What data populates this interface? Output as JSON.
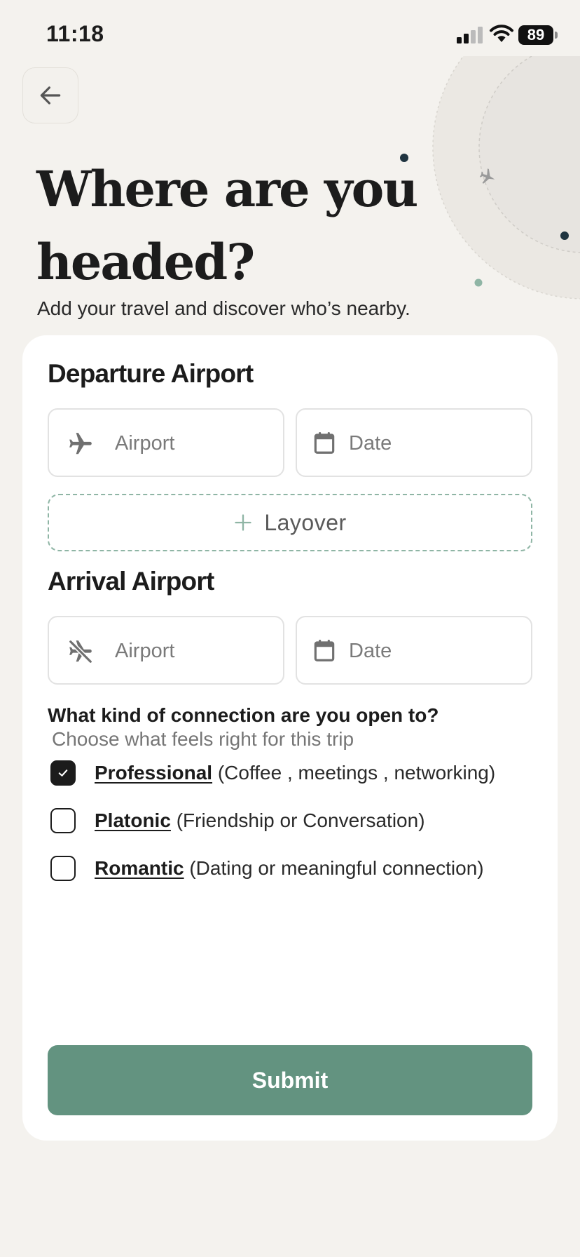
{
  "status_bar": {
    "time": "11:18",
    "battery_level": "89",
    "signal_bars_active": 2,
    "signal_bars_total": 4
  },
  "header": {
    "title": "Where are you headed?",
    "subtitle": "Add your travel and discover who’s nearby."
  },
  "departure": {
    "section_title": "Departure Airport",
    "airport_placeholder": "Airport",
    "date_placeholder": "Date",
    "airport_icon": "airplane-icon",
    "date_icon": "calendar-icon"
  },
  "layover": {
    "label": "Layover",
    "icon": "plus-icon"
  },
  "arrival": {
    "section_title": "Arrival Airport",
    "airport_placeholder": "Airport",
    "date_placeholder": "Date",
    "airport_icon": "airplane-off-icon",
    "date_icon": "calendar-icon"
  },
  "connection": {
    "question": "What kind of connection are you open to?",
    "hint": "Choose what feels right for this trip",
    "options": [
      {
        "name": "Professional",
        "description": "(Coffee , meetings , networking)",
        "checked": true
      },
      {
        "name": "Platonic",
        "description": "(Friendship or Conversation)",
        "checked": false
      },
      {
        "name": "Romantic",
        "description": "(Dating or meaningful connection)",
        "checked": false
      }
    ]
  },
  "submit": {
    "label": "Submit"
  },
  "colors": {
    "background": "#f4f2ee",
    "card": "#ffffff",
    "accent": "#639380",
    "dashed_border": "#8fb5a5",
    "text_primary": "#1c1c1c",
    "text_muted": "#7a7a7a"
  }
}
